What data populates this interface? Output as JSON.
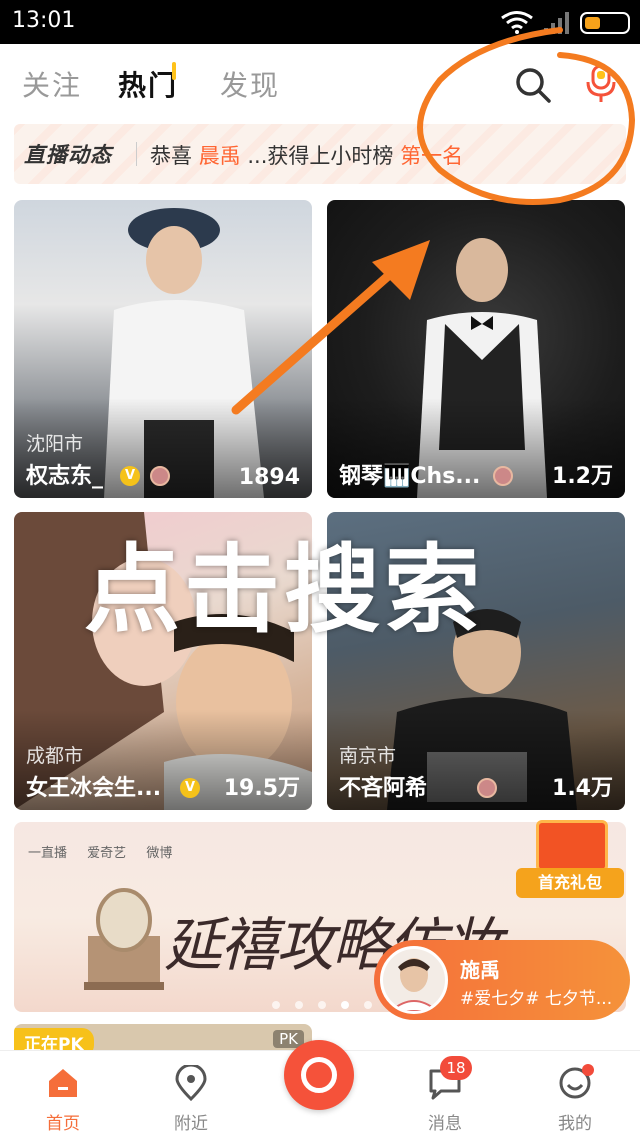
{
  "status_bar": {
    "time": "13:01"
  },
  "top_nav": {
    "tabs": [
      {
        "label": "关注"
      },
      {
        "label": "热门",
        "active": true
      },
      {
        "label": "发现"
      }
    ]
  },
  "ticker": {
    "brand": "直播动态",
    "prefix": "恭喜",
    "highlight_name": "晨禹",
    "middle": " ...获得上小时榜",
    "rank": "第一名"
  },
  "live_cards": [
    {
      "city": "沈阳市",
      "name": "权志东_",
      "viewers": "1894"
    },
    {
      "city": "",
      "name": "钢琴🎹Chs...",
      "viewers": "1.2万"
    },
    {
      "city": "成都市",
      "name": "女王冰会生...",
      "viewers": "19.5万"
    },
    {
      "city": "南京市",
      "name": "不吝阿希",
      "viewers": "1.4万"
    }
  ],
  "overlay_caption": "点击搜索",
  "banner": {
    "logos": [
      "一直播",
      "爱奇艺",
      "微博"
    ],
    "headline": "延禧攻略仿妆",
    "page_count": 7,
    "active_index": 3
  },
  "gift": {
    "label": "首充礼包"
  },
  "floating_live": {
    "name": "施禹",
    "tags": "#爱七夕# 七夕节..."
  },
  "pk_card": {
    "label": "正在PK",
    "badge": "PK"
  },
  "bottom_nav": {
    "items": [
      {
        "label": "首页",
        "active": true
      },
      {
        "label": "附近"
      },
      {
        "label": ""
      },
      {
        "label": "消息"
      },
      {
        "label": "我的"
      }
    ],
    "message_badge": "18"
  },
  "colors": {
    "accent": "#f56e3a",
    "annotation": "#f47b20",
    "highlight": "#ff6633"
  }
}
